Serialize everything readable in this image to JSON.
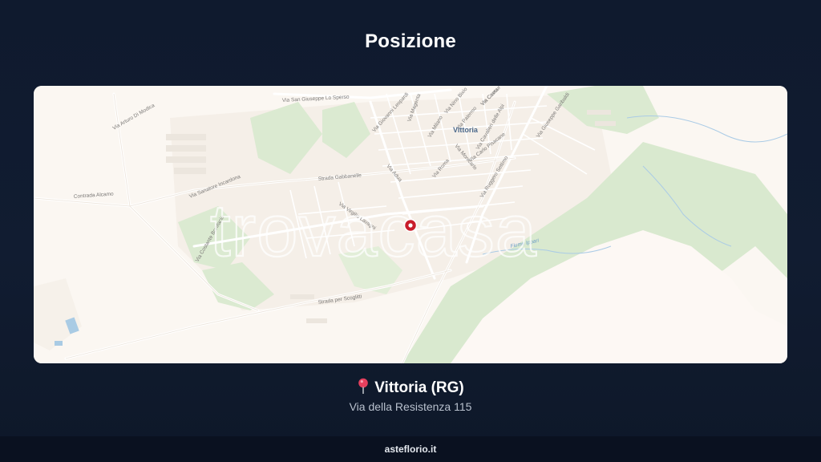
{
  "page": {
    "title": "Posizione"
  },
  "map": {
    "watermark": "trovacasa",
    "city_label": "Vittoria",
    "street_labels": [
      "Via Arturo Di Modica",
      "Via San Giuseppe Lo Sperso",
      "Via Sanatore Incardona",
      "Strada Gabbanelle",
      "Via Giovanni Leopardi",
      "Via Nino Bixio",
      "Via Cavour",
      "Via Magenta",
      "Via Milano",
      "Via Palermo",
      "Via Carlo Pisacane",
      "Via Cavalieri delle Alpi",
      "Via Adua",
      "Via Roma",
      "Via Ruggero Settimo",
      "Via Giuseppe Garibaldi",
      "Via Monicarlo",
      "Via Costante Bonifacio",
      "Strada per Scoglitti",
      "Contrada Alcamo",
      "Via Virgilio Lavagni",
      "Fiume Ippari",
      "Via Caeta"
    ]
  },
  "location": {
    "city": "Vittoria (RG)",
    "address": "Via della Resistenza 115",
    "pin_icon": "round-pushpin-icon",
    "pin_color": "#e5405e"
  },
  "footer": {
    "brand": "asteflorio.it"
  },
  "colors": {
    "background": "#111c31",
    "map_base": "#fbf7f2",
    "park_green": "#d6e8cc",
    "marker_red": "#c91d2b"
  }
}
